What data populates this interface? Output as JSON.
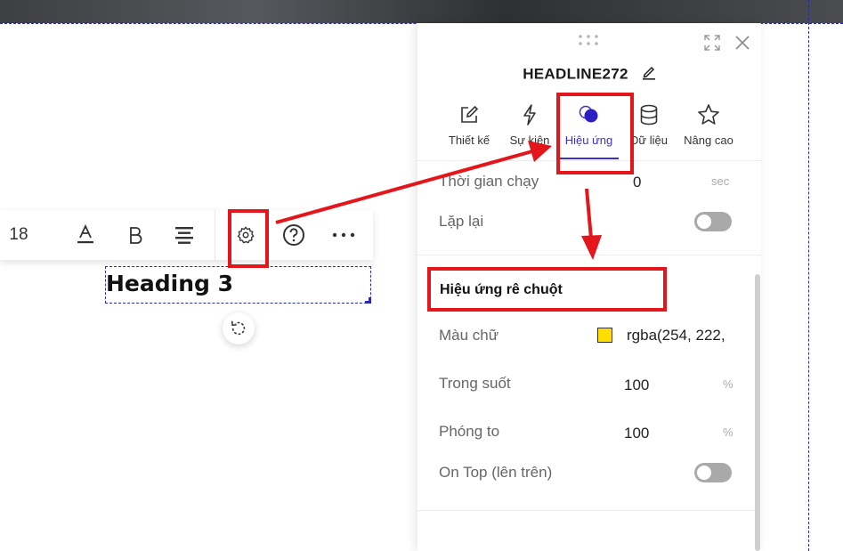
{
  "toolbar": {
    "font_size": "18",
    "icons": [
      "text-color-icon",
      "bold-icon",
      "align-center-icon",
      "settings-icon",
      "help-icon",
      "more-icon"
    ]
  },
  "canvas": {
    "heading_text": "Heading 3"
  },
  "panel": {
    "title": "HEADLINE272",
    "tabs": [
      {
        "label": "Thiết kế",
        "icon": "edit-icon"
      },
      {
        "label": "Sự kiện",
        "icon": "bolt-icon"
      },
      {
        "label": "Hiệu ứng",
        "icon": "effect-icon",
        "active": true
      },
      {
        "label": "Dữ liệu",
        "icon": "database-icon"
      },
      {
        "label": "Nâng cao",
        "icon": "star-icon"
      }
    ],
    "run_time": {
      "label": "Thời gian chạy",
      "value": "0",
      "unit": "sec"
    },
    "repeat": {
      "label": "Lặp lại",
      "on": false
    },
    "hover_section_title": "Hiệu ứng rê chuột",
    "text_color": {
      "label": "Màu chữ",
      "value": "rgba(254, 222,",
      "swatch": "#fede00"
    },
    "opacity": {
      "label": "Trong suốt",
      "value": "100",
      "unit": "%"
    },
    "zoom": {
      "label": "Phóng to",
      "value": "100",
      "unit": "%"
    },
    "on_top": {
      "label": "On Top (lên trên)",
      "on": false
    }
  },
  "colors": {
    "accent": "#3a2fd1",
    "annotation": "#e4151b",
    "guide": "#2a2ab0"
  }
}
